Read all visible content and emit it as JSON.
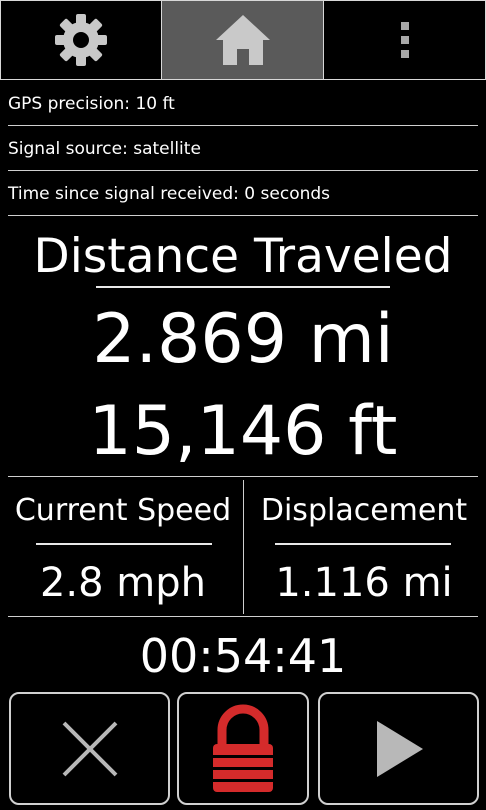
{
  "tabs": {
    "settings_icon": "gear-icon",
    "home_icon": "home-icon",
    "more_icon": "more-vertical-icon"
  },
  "info": {
    "gps_precision": "GPS precision: 10 ft",
    "signal_source": "Signal source: satellite",
    "time_since_signal": "Time since signal received: 0 seconds"
  },
  "distance": {
    "title": "Distance Traveled",
    "miles": "2.869 mi",
    "feet": "15,146 ft"
  },
  "speed": {
    "title": "Current Speed",
    "value": "2.8 mph"
  },
  "displacement": {
    "title": "Displacement",
    "value": "1.116 mi"
  },
  "timer": "00:54:41",
  "buttons": {
    "cancel_icon": "close-icon",
    "lock_icon": "lock-icon",
    "play_icon": "play-icon"
  },
  "colors": {
    "background": "#000000",
    "text": "#ffffff",
    "active_tab": "#5a5a5a",
    "lock_red": "#d42b2b",
    "icon_gray": "#b8b8b8"
  }
}
